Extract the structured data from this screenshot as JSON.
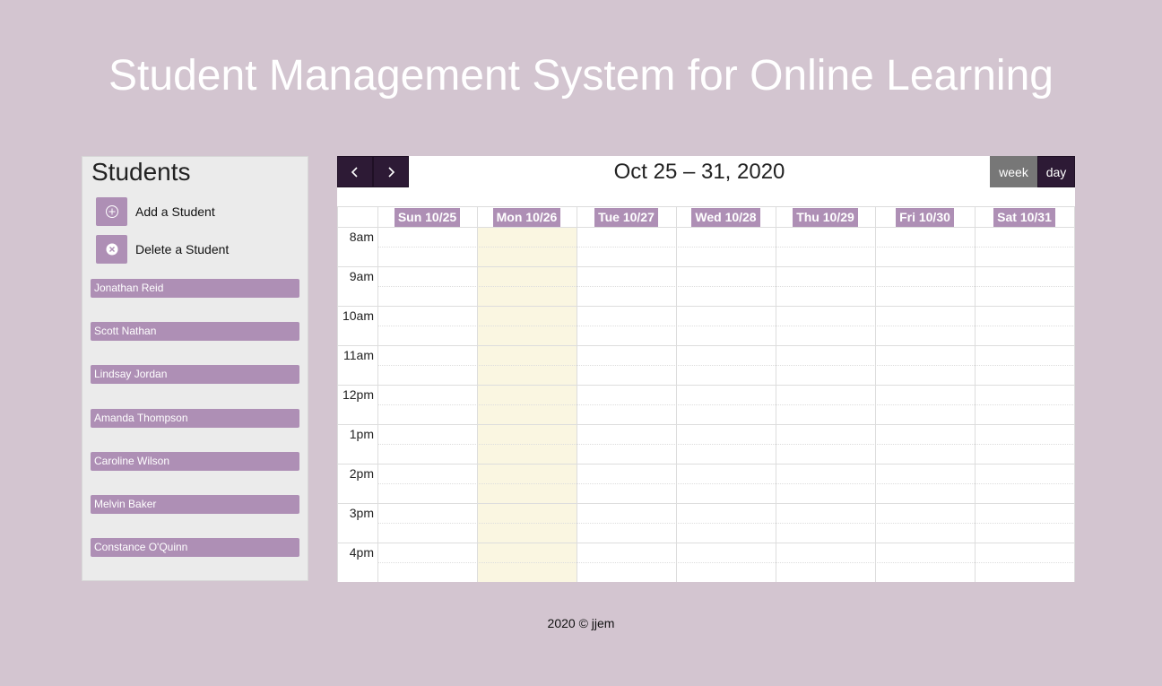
{
  "page": {
    "title": "Student Management System for Online Learning",
    "footer": "2020 © jjem"
  },
  "sidebar": {
    "heading": "Students",
    "actions": [
      {
        "label": "Add a Student",
        "icon": "plus-circle-icon"
      },
      {
        "label": "Delete a Student",
        "icon": "x-circle-icon"
      }
    ],
    "students": [
      "Jonathan Reid",
      "Scott Nathan",
      "Lindsay Jordan",
      "Amanda Thompson",
      "Caroline Wilson",
      "Melvin Baker",
      "Constance O'Quinn"
    ]
  },
  "calendar": {
    "range_title": "Oct 25 – 31, 2020",
    "views": {
      "week": "week",
      "day": "day"
    },
    "days": [
      "Sun 10/25",
      "Mon 10/26",
      "Tue 10/27",
      "Wed 10/28",
      "Thu 10/29",
      "Fri 10/30",
      "Sat 10/31"
    ],
    "hours": [
      "8am",
      "9am",
      "10am",
      "11am",
      "12pm",
      "1pm",
      "2pm",
      "3pm",
      "4pm"
    ],
    "today": "Mon 10/26"
  },
  "colors": {
    "background": "#d3c5d0",
    "accent": "#ae8fb5",
    "nav_dark": "#2d1a35",
    "today_highlight": "#faf6e1",
    "inactive_view": "#777777"
  }
}
